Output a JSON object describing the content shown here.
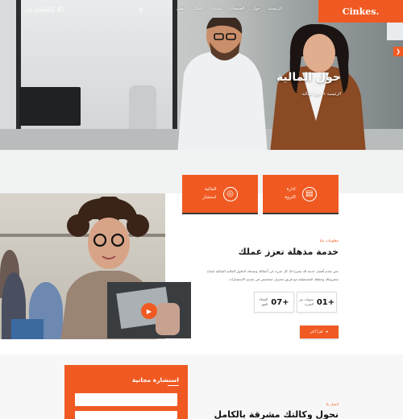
{
  "brand": {
    "logo_text": "Cinkes.",
    "accent": "#f05a22"
  },
  "header": {
    "nav_items": [
      "الرئيسية",
      "حول",
      "الصفحات",
      "مدونة",
      "اعمال",
      "اتصل"
    ],
    "phone_label": "اتصل بنا",
    "phone_number": "+91-00000000",
    "icons": [
      "search-icon",
      "phone-icon",
      "arrow-right-icon"
    ]
  },
  "hero": {
    "title": "حول المالية",
    "breadcrumb": "الرئيسية > حول المالية"
  },
  "features": [
    {
      "label": "ادارة\nالثروة",
      "icon": "presentation-icon"
    },
    {
      "label": "المالية\nاستشار",
      "icon": "target-icon"
    }
  ],
  "about": {
    "subtitle": "معلومات عنا",
    "heading": "خدمة مذهلة تعزز عملك",
    "paragraph": "نحن نقدم أفضل خدمة لك تشرح لك كل شيء عن أعمالك وتمنحك الحلول المالية المثالية لنجاح مشروعك وخطتك المستقبلية مع فريق محترف متخصص في تقديم الاستشارات",
    "stats": [
      {
        "number": "01+",
        "label": "سنوات من\nالخبرة"
      },
      {
        "number": "07+",
        "label": "العملاء\nالفوز"
      }
    ],
    "button_label": "اقرأ أكثر",
    "play_icon": "play-icon"
  },
  "consult": {
    "heading": "استشارة مجانية",
    "fields": [
      "",
      ""
    ]
  },
  "bottom": {
    "subtitle": "اتصل بنا",
    "heading": "نحول وكالتك مشرقة بالكامل"
  }
}
